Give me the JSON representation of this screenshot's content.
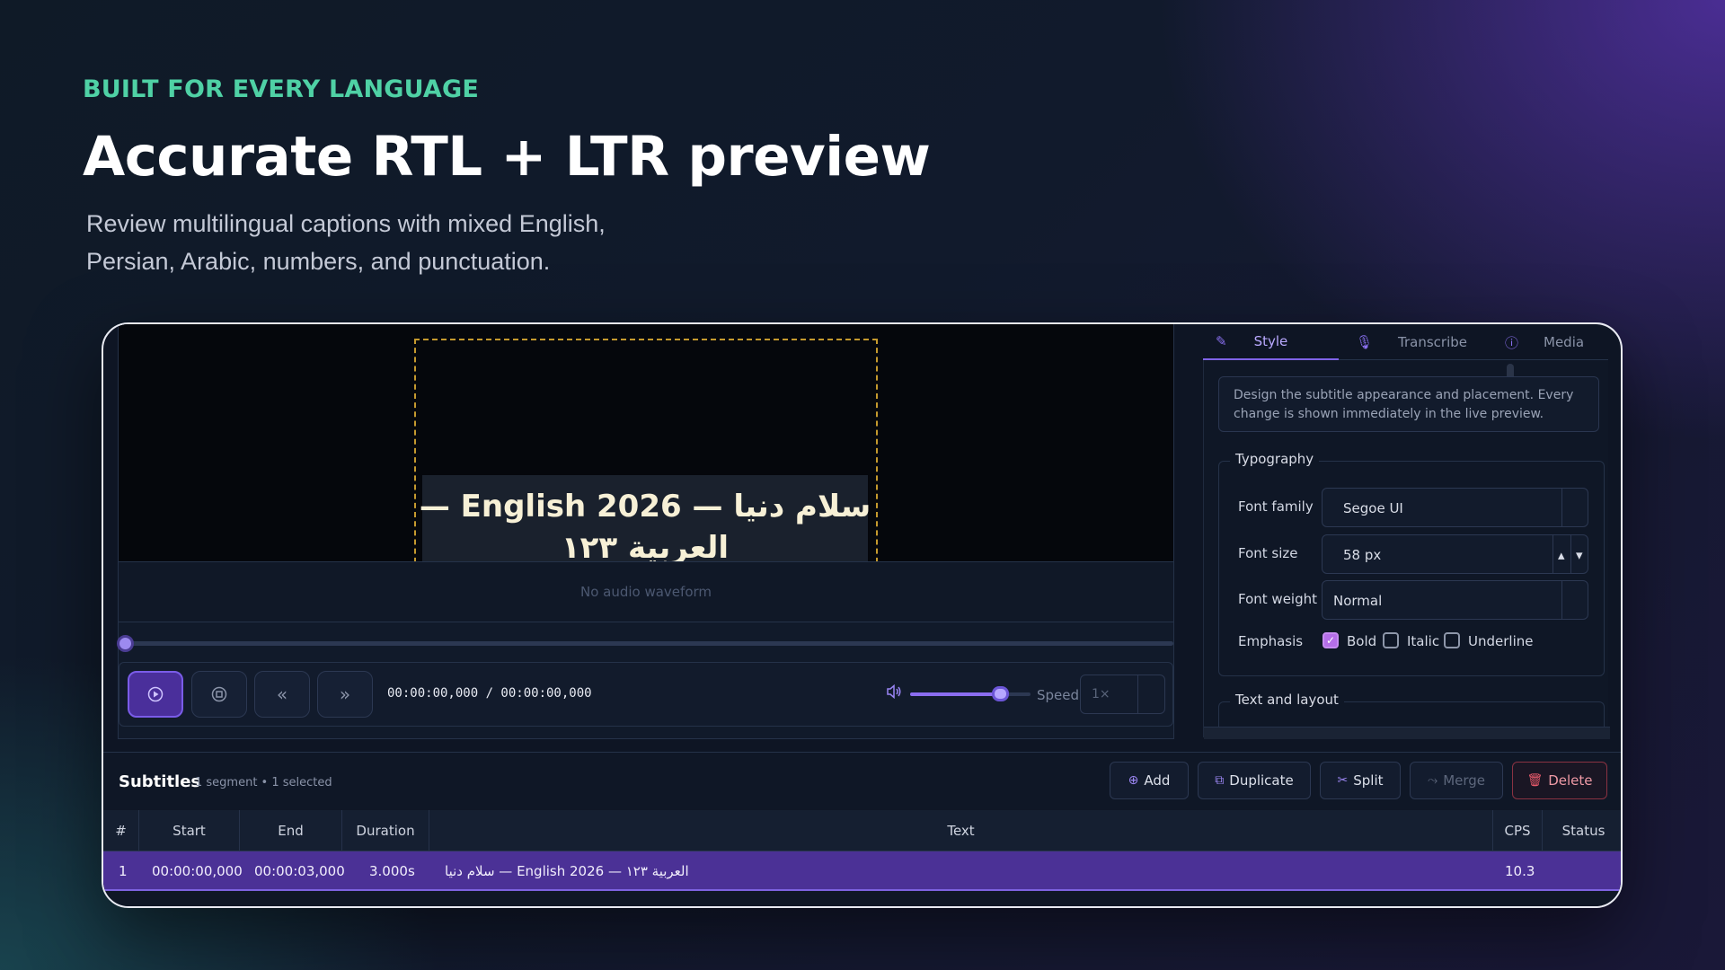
{
  "hero": {
    "eyebrow": "BUILT FOR EVERY LANGUAGE",
    "headline": "Accurate RTL + LTR preview",
    "subline_1": "Review multilingual captions with mixed English,",
    "subline_2": "Persian, Arabic, numbers, and punctuation."
  },
  "preview": {
    "caption_line_1": "سلام دنیا — English 2026 —",
    "caption_line_2": "العربية ١٢٣",
    "waveform_placeholder": "No audio waveform",
    "progress": 0
  },
  "transport": {
    "play_icon": "play-icon",
    "stop_icon": "stop-icon",
    "rewind_icon": "rewind-icon",
    "forward_icon": "fast-forward-icon",
    "timecode": "00:00:00,000 / 00:00:00,000",
    "volume_level": 0.75,
    "speed_label": "Speed",
    "speed_value": "1×"
  },
  "tabs": [
    {
      "label": "Style",
      "icon": "pencil-icon",
      "active": true
    },
    {
      "label": "Transcribe",
      "icon": "microphone-icon",
      "active": false
    },
    {
      "label": "Media",
      "icon": "info-icon",
      "active": false
    }
  ],
  "style_panel": {
    "info": "Design the subtitle appearance and placement. Every change is shown immediately in the live preview.",
    "typography_legend": "Typography",
    "font_family_label": "Font family",
    "font_family_value": "Segoe UI",
    "font_size_label": "Font size",
    "font_size_value": "58 px",
    "font_weight_label": "Font weight",
    "font_weight_value": "Normal",
    "emphasis_label": "Emphasis",
    "bold_label": "Bold",
    "bold_checked": true,
    "italic_label": "Italic",
    "italic_checked": false,
    "underline_label": "Underline",
    "underline_checked": false,
    "text_layout_legend": "Text and layout"
  },
  "subtitles": {
    "title": "Subtitles",
    "meta": "1 segment  •  1 selected",
    "buttons": {
      "add": "Add",
      "duplicate": "Duplicate",
      "split": "Split",
      "merge": "Merge",
      "delete": "Delete"
    },
    "columns": [
      "#",
      "Start",
      "End",
      "Duration",
      "Text",
      "CPS",
      "Status"
    ],
    "rows": [
      {
        "index": "1",
        "start": "00:00:00,000",
        "end": "00:00:03,000",
        "duration": "3.000s",
        "text": "سلام دنیا — English 2026 — العربية ١٢٣",
        "cps": "10.3",
        "status": ""
      }
    ]
  },
  "colors": {
    "accent": "#7f63e8",
    "eyebrow": "#4fd1a5",
    "selected_row": "#4b3196",
    "danger": "#e85a6b"
  }
}
